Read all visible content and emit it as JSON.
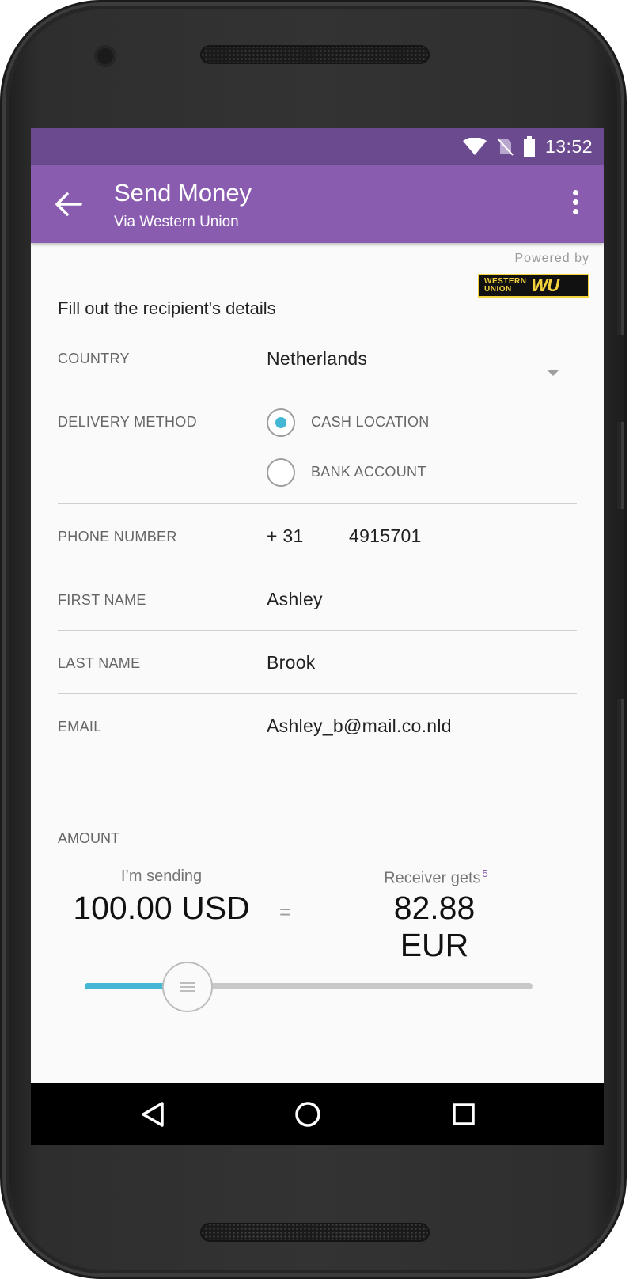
{
  "status_bar": {
    "time": "13:52",
    "icons": [
      "wifi-icon",
      "no-sim-icon",
      "battery-icon"
    ]
  },
  "app_bar": {
    "title": "Send Money",
    "subtitle": "Via Western Union",
    "back_icon": "arrow-left-icon",
    "menu_icon": "more-vert-icon"
  },
  "branding": {
    "powered_by": "Powered by",
    "logo_text_top": "WESTERN",
    "logo_text_bottom": "UNION",
    "logo_mark": "WU"
  },
  "form": {
    "heading": "Fill out the recipient's details",
    "country": {
      "label": "COUNTRY",
      "value": "Netherlands"
    },
    "delivery": {
      "label": "DELIVERY METHOD",
      "options": [
        {
          "label": "CASH LOCATION",
          "selected": true
        },
        {
          "label": "BANK ACCOUNT",
          "selected": false
        }
      ]
    },
    "phone": {
      "label": "PHONE NUMBER",
      "prefix": "+ 31",
      "number": "4915701"
    },
    "first_name": {
      "label": "FIRST NAME",
      "value": "Ashley"
    },
    "last_name": {
      "label": "LAST NAME",
      "value": "Brook"
    },
    "email": {
      "label": "EMAIL",
      "value": "Ashley_b@mail.co.nld"
    }
  },
  "amount": {
    "label": "AMOUNT",
    "sending_caption": "I’m sending",
    "sending_value": "100.00 USD",
    "equals": "=",
    "receiving_caption": "Receiver gets",
    "receiving_footnote": "5",
    "receiving_value": "82.88 EUR",
    "slider_level": 0.23
  },
  "colors": {
    "status_bar": "#6c4a8f",
    "app_bar": "#8a5cb0",
    "accent": "#43b7d3",
    "wu_yellow": "#f4d23c"
  },
  "nav": {
    "icons": [
      "back-triangle-icon",
      "home-circle-icon",
      "recents-square-icon"
    ]
  }
}
